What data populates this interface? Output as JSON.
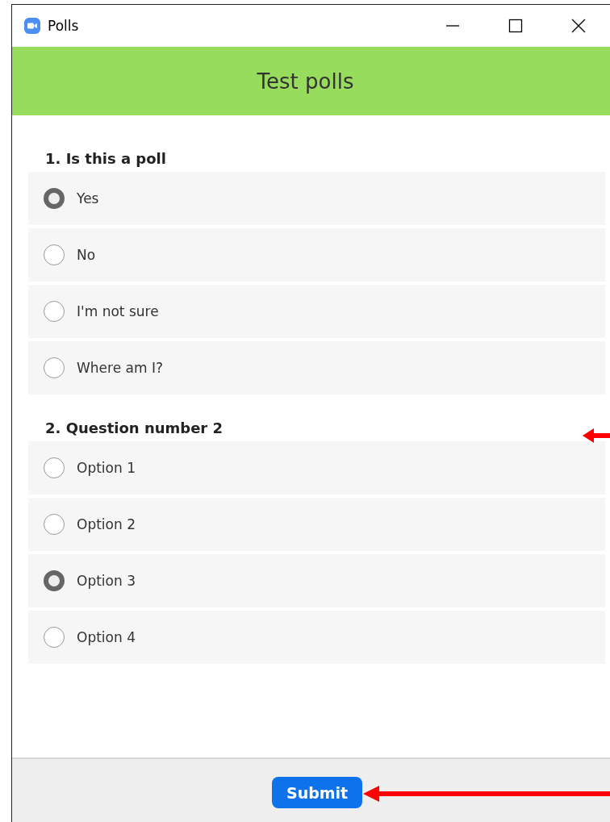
{
  "window": {
    "title": "Polls"
  },
  "header": {
    "title": "Test polls"
  },
  "questions": [
    {
      "title": "1. Is this a poll",
      "options": [
        {
          "label": "Yes",
          "selected": true
        },
        {
          "label": "No",
          "selected": false
        },
        {
          "label": "I'm not sure",
          "selected": false
        },
        {
          "label": "Where am I?",
          "selected": false
        }
      ]
    },
    {
      "title": "2. Question number 2",
      "options": [
        {
          "label": "Option 1",
          "selected": false
        },
        {
          "label": "Option 2",
          "selected": false
        },
        {
          "label": "Option 3",
          "selected": true
        },
        {
          "label": "Option 4",
          "selected": false
        }
      ]
    }
  ],
  "footer": {
    "button": "Submit"
  }
}
